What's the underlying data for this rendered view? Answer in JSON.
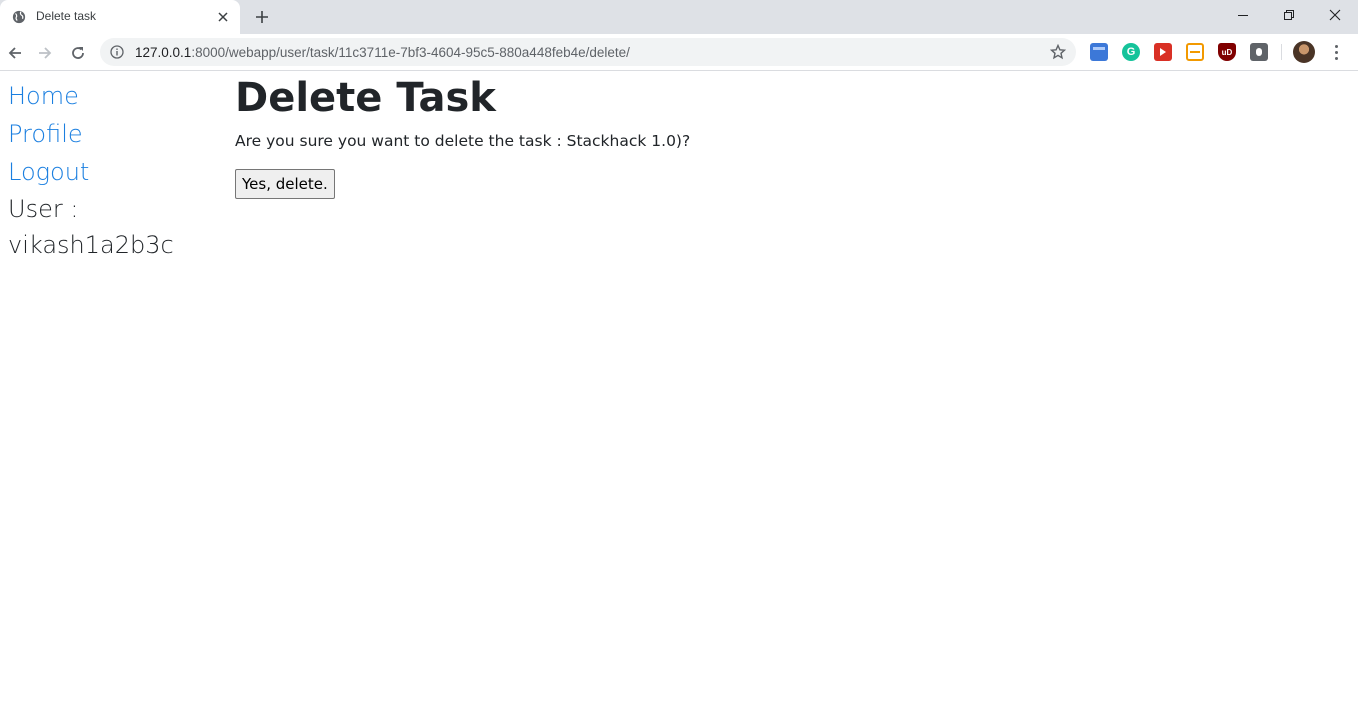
{
  "browser": {
    "tab": {
      "title": "Delete task",
      "favicon": "globe-icon"
    },
    "url": {
      "host": "127.0.0.1",
      "rest": ":8000/webapp/user/task/11c3711e-7bf3-4604-95c5-880a448feb4e/delete/"
    },
    "extensions": [
      {
        "name": "ext-blue-icon",
        "color": "#3c78d8"
      },
      {
        "name": "grammarly-icon",
        "color": "#15c39a"
      },
      {
        "name": "ext-red-play-icon",
        "color": "#d93025"
      },
      {
        "name": "ext-orange-layout-icon",
        "color": "#f29900"
      },
      {
        "name": "ublock-icon",
        "color": "#800000"
      },
      {
        "name": "ext-bulb-icon",
        "color": "#5f6368"
      }
    ]
  },
  "sidebar": {
    "links": [
      "Home",
      "Profile",
      "Logout"
    ],
    "user_label": "User :",
    "username": "vikash1a2b3c"
  },
  "main": {
    "title": "Delete Task",
    "confirm": "Are you sure you want to delete the task : Stackhack 1.0)?",
    "button": "Yes, delete."
  },
  "colors": {
    "link": "#1b7fe0",
    "text": "#212529"
  }
}
